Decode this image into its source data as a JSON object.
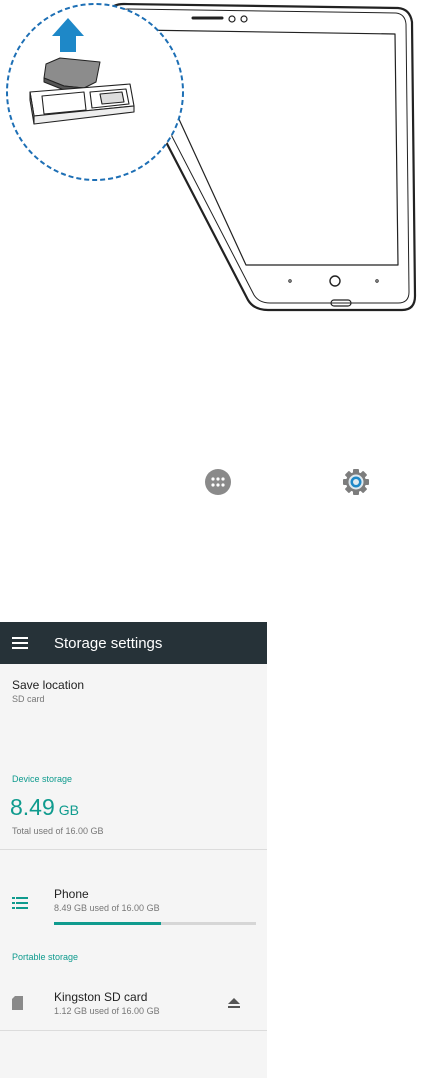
{
  "toolbar": {
    "title": "Storage settings",
    "menu_icon": "menu-icon"
  },
  "save_location": {
    "label": "Save location",
    "value": "SD card"
  },
  "device_storage": {
    "header": "Device storage",
    "used_value": "8.49",
    "used_unit": "GB",
    "total_text": "Total used of 16.00 GB"
  },
  "phone": {
    "name": "Phone",
    "usage": "8.49 GB used of 16.00 GB",
    "used_fraction": 0.53,
    "icon": "storage-list-icon"
  },
  "portable_storage": {
    "header": "Portable storage"
  },
  "sd_card": {
    "name": "Kingston SD card",
    "usage": "1.12 GB used of 16.00 GB",
    "icon": "sd-card-icon",
    "action_icon": "eject-icon"
  },
  "colors": {
    "accent": "#0f9b8e",
    "toolbar": "#263238",
    "icon_blue": "#1e88c8"
  }
}
